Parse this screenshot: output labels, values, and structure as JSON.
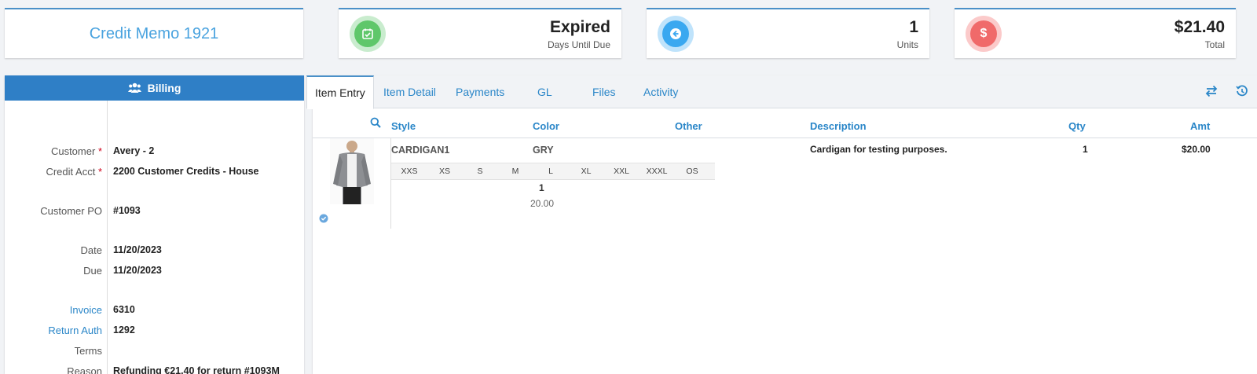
{
  "title": "Credit Memo 1921",
  "stats": {
    "due": {
      "value": "Expired",
      "label": "Days Until Due",
      "color": "#5fc76a",
      "icon": "calendar-check-icon"
    },
    "units": {
      "value": "1",
      "label": "Units",
      "color": "#3aa8f0",
      "icon": "arrow-left-circle-icon"
    },
    "total": {
      "value": "$21.40",
      "label": "Total",
      "color": "#f06a6a",
      "icon": "dollar-icon"
    }
  },
  "billing": {
    "header": "Billing",
    "fields": {
      "customer": {
        "label": "Customer",
        "value": "Avery - 2"
      },
      "credit_acct": {
        "label": "Credit Acct",
        "value": "2200 Customer Credits - House"
      },
      "customer_po": {
        "label": "Customer PO",
        "value": "#1093"
      },
      "date": {
        "label": "Date",
        "value": "11/20/2023"
      },
      "due": {
        "label": "Due",
        "value": "11/20/2023"
      },
      "invoice": {
        "label": "Invoice",
        "value": "6310"
      },
      "return_auth": {
        "label": "Return Auth",
        "value": "1292"
      },
      "terms": {
        "label": "Terms",
        "value": ""
      },
      "reason": {
        "label": "Reason",
        "value": "Refunding €21.40 for return #1093M"
      }
    }
  },
  "tabs": [
    "Item Entry",
    "Item Detail",
    "Payments",
    "GL",
    "Files",
    "Activity"
  ],
  "grid": {
    "columns": {
      "style": "Style",
      "color": "Color",
      "other": "Other",
      "description": "Description",
      "qty": "Qty",
      "amt": "Amt"
    },
    "item": {
      "style": "CARDIGAN1",
      "color": "GRY",
      "description": "Cardigan for testing purposes.",
      "qty": "1",
      "amt": "$20.00",
      "sizes": [
        "XXS",
        "XS",
        "S",
        "M",
        "L",
        "XL",
        "XXL",
        "XXXL",
        "OS"
      ],
      "size_qty": "1",
      "size_price": "20.00"
    }
  }
}
